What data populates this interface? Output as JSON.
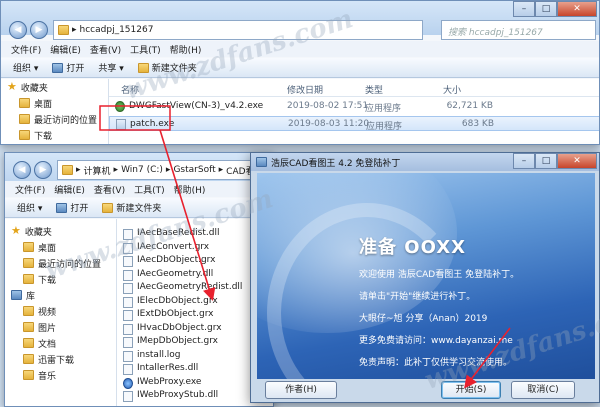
{
  "win1": {
    "path": [
      "hccadpj_151267"
    ],
    "search_placeholder": "搜索 hccadpj_151267",
    "menu": [
      "文件(F)",
      "编辑(E)",
      "查看(V)",
      "工具(T)",
      "帮助(H)"
    ],
    "toolbar": [
      "组织 ▾",
      "打开",
      "共享 ▾",
      "新建文件夹"
    ],
    "nav": [
      {
        "label": "收藏夹",
        "icon": "star-icon",
        "sub": false
      },
      {
        "label": "桌面",
        "icon": "desktop-icon",
        "sub": true
      },
      {
        "label": "最近访问的位置",
        "icon": "recent-places-icon",
        "sub": true
      },
      {
        "label": "下载",
        "icon": "downloads-icon",
        "sub": true
      }
    ],
    "columns": [
      "名称",
      "修改日期",
      "类型",
      "大小"
    ],
    "files": [
      {
        "name": "DWGFastView(CN-3)_v4.2.exe",
        "date": "2019-08-02 17:51",
        "type": "应用程序",
        "size": "62,721 KB",
        "icon": "g"
      },
      {
        "name": "patch.exe",
        "date": "2019-08-03 11:20",
        "type": "应用程序",
        "size": "683 KB",
        "icon": "exe"
      }
    ]
  },
  "win2": {
    "path": [
      "计算机",
      "Win7 (C:)",
      "GstarSoft",
      "CAD看图"
    ],
    "menu": [
      "文件(F)",
      "编辑(E)",
      "查看(V)",
      "工具(T)",
      "帮助(H)"
    ],
    "toolbar": [
      "组织 ▾",
      "打开",
      "新建文件夹"
    ],
    "nav": [
      {
        "label": "收藏夹",
        "icon": "star-icon",
        "sub": false
      },
      {
        "label": "桌面",
        "icon": "desktop-icon",
        "sub": true
      },
      {
        "label": "最近访问的位置",
        "icon": "recent-places-icon",
        "sub": true
      },
      {
        "label": "下载",
        "icon": "downloads-icon",
        "sub": true
      },
      {
        "label": "库",
        "icon": "library-icon",
        "sub": false
      },
      {
        "label": "视频",
        "icon": "video-icon",
        "sub": true
      },
      {
        "label": "图片",
        "icon": "pictures-icon",
        "sub": true
      },
      {
        "label": "文档",
        "icon": "documents-icon",
        "sub": true
      },
      {
        "label": "迅雷下载",
        "icon": "thunder-download-icon",
        "sub": true
      },
      {
        "label": "音乐",
        "icon": "music-icon",
        "sub": true
      }
    ],
    "files": [
      {
        "name": "IAecBaseRedist.dll",
        "icon": "file"
      },
      {
        "name": "IAecConvert.grx",
        "icon": "file"
      },
      {
        "name": "IAecDbObject.grx",
        "icon": "file"
      },
      {
        "name": "IAecGeometry.dll",
        "icon": "file"
      },
      {
        "name": "IAecGeometryRedist.dll",
        "icon": "file"
      },
      {
        "name": "IElecDbObject.grx",
        "icon": "file"
      },
      {
        "name": "IExtDbObject.grx",
        "icon": "file"
      },
      {
        "name": "IHvacDbObject.grx",
        "icon": "file"
      },
      {
        "name": "IMepDbObject.grx",
        "icon": "file"
      },
      {
        "name": "install.log",
        "icon": "file"
      },
      {
        "name": "IntallerRes.dll",
        "icon": "file"
      },
      {
        "name": "IWebProxy.exe",
        "icon": "ie"
      },
      {
        "name": "IWebProxyStub.dll",
        "icon": "file"
      }
    ]
  },
  "dialog": {
    "title": "浩辰CAD看图王 4.2 免登陆补丁",
    "heading": "准备 OOXX",
    "lines": [
      "欢迎使用 浩辰CAD看图王 免登陆补丁。",
      "请单击\"开始\"继续进行补丁。",
      "大眼仔~旭 分享（Anan）2019",
      "更多免费请访问：www.dayanzai.me",
      "免责声明：此补丁仅供学习交流使用。"
    ],
    "author_button": "作者(H)",
    "start_button": "开始(S)",
    "cancel_button": "取消(C)"
  },
  "watermark": "www.zdfans.com",
  "colors": {
    "arrow": "#e8212e",
    "dialog_blue": "#2d64b6"
  }
}
